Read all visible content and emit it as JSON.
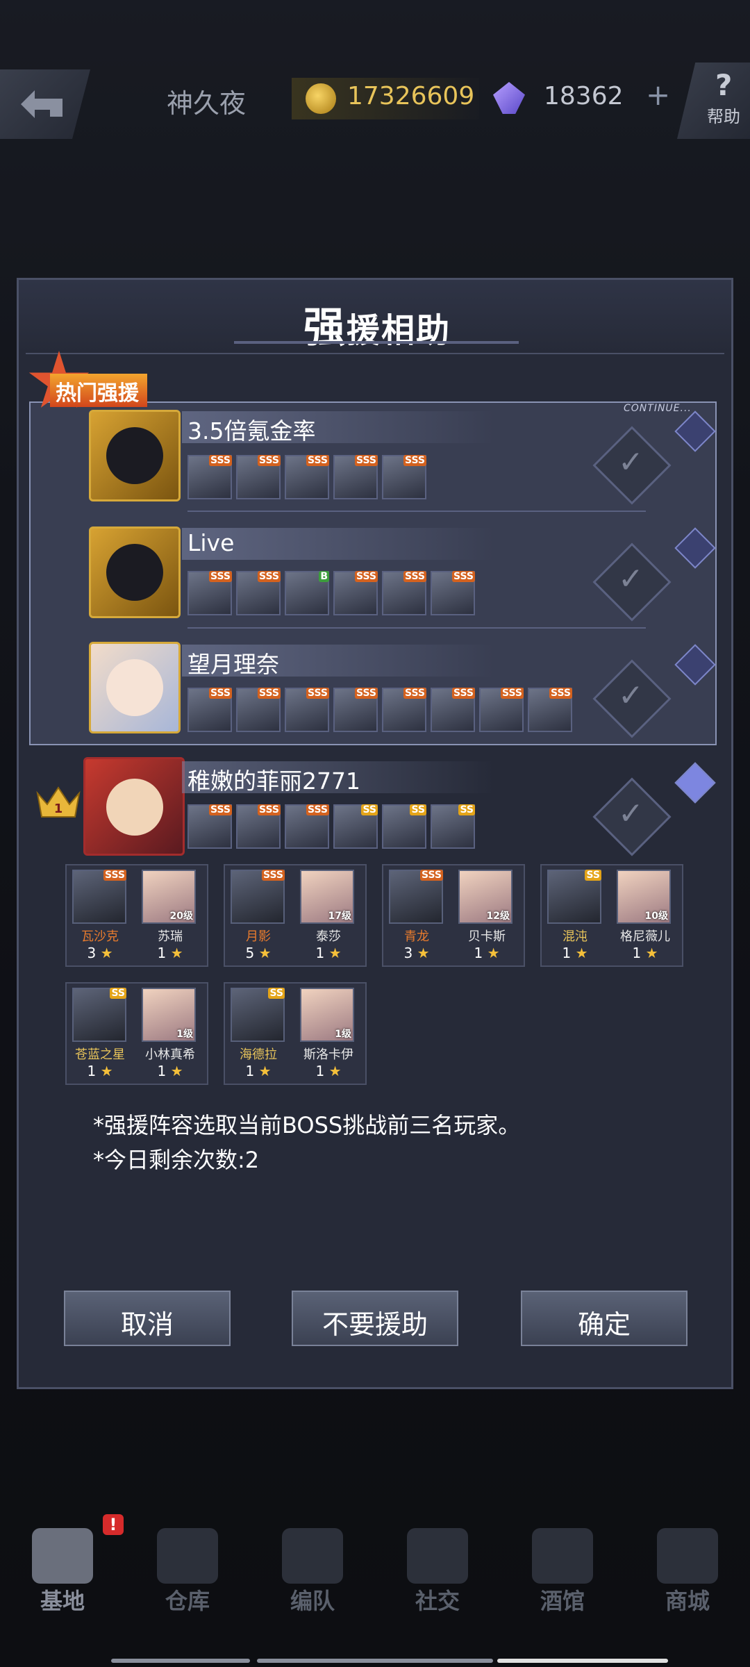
{
  "topbar": {
    "player_name": "神久夜",
    "gold": "17326609",
    "gems": "18362",
    "plus": "+",
    "help_q": "?",
    "help_label": "帮助"
  },
  "dialog": {
    "title_big": "强",
    "title_rest": "援相助",
    "continue_tag": "CONTINUE...",
    "hot_label": "热门强援",
    "crown_rank": "1",
    "players": [
      {
        "name": "3.5倍氪金率",
        "units": [
          "SSS",
          "SSS",
          "SSS",
          "SSS",
          "SSS"
        ]
      },
      {
        "name": "Live",
        "units": [
          "SSS",
          "SSS",
          "B",
          "SSS",
          "SSS",
          "SSS"
        ]
      },
      {
        "name": "望月理奈",
        "units": [
          "SSS",
          "SSS",
          "SSS",
          "SSS",
          "SSS",
          "SSS",
          "SSS",
          "SSS"
        ]
      },
      {
        "name": "稚嫩的菲丽2771",
        "units": [
          "SSS",
          "SSS",
          "SSS",
          "SS",
          "SS",
          "SS"
        ]
      }
    ],
    "cards": [
      {
        "mech_tag": "SSS",
        "mech": "瓦沙克",
        "mech_star": "3",
        "pilot": "苏瑞",
        "pilot_lvl": "20级",
        "pilot_star": "1"
      },
      {
        "mech_tag": "SSS",
        "mech": "月影",
        "mech_star": "5",
        "pilot": "泰莎",
        "pilot_lvl": "17级",
        "pilot_star": "1"
      },
      {
        "mech_tag": "SSS",
        "mech": "青龙",
        "mech_star": "3",
        "pilot": "贝卡斯",
        "pilot_lvl": "12级",
        "pilot_star": "1"
      },
      {
        "mech_tag": "SS",
        "mech": "混沌",
        "mech_star": "1",
        "pilot": "格尼薇儿",
        "pilot_lvl": "10级",
        "pilot_star": "1"
      },
      {
        "mech_tag": "SS",
        "mech": "苍蓝之星",
        "mech_star": "1",
        "pilot": "小林真希",
        "pilot_lvl": "1级",
        "pilot_star": "1"
      },
      {
        "mech_tag": "SS",
        "mech": "海德拉",
        "mech_star": "1",
        "pilot": "斯洛卡伊",
        "pilot_lvl": "1级",
        "pilot_star": "1"
      }
    ],
    "note1": "*强援阵容选取当前BOSS挑战前三名玩家。",
    "note2": "*今日剩余次数:2",
    "btn_cancel": "取消",
    "btn_no_help": "不要援助",
    "btn_confirm": "确定"
  },
  "colors": {
    "mech_orange": "#e87b2d",
    "mech_gold": "#e8c45a"
  },
  "nav": {
    "badge": "!",
    "items": [
      "基地",
      "仓库",
      "编队",
      "社交",
      "酒馆",
      "商城"
    ]
  }
}
